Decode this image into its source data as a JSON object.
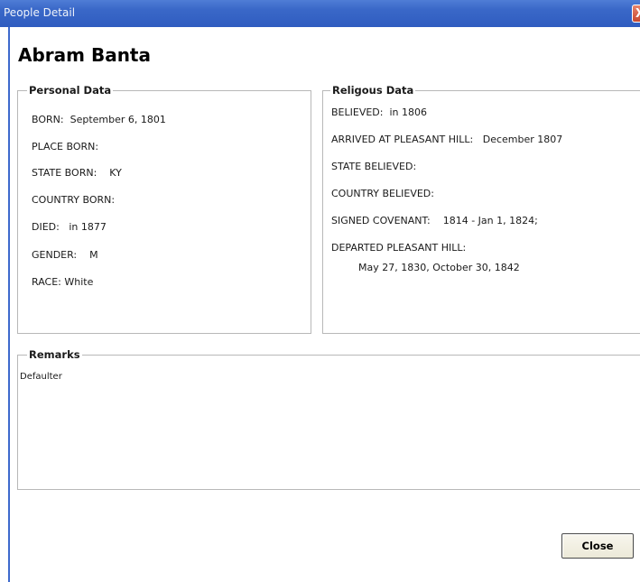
{
  "window": {
    "title": "People Detail",
    "close_glyph": "X"
  },
  "person": {
    "name": "Abram Banta"
  },
  "personal": {
    "legend": "Personal Data",
    "born": "BORN:  September 6, 1801",
    "place_born": "PLACE BORN:",
    "state_born": "STATE BORN:    KY",
    "country_born": "COUNTRY BORN:",
    "died": "DIED:   in 1877",
    "gender": "GENDER:    M",
    "race": "RACE: White"
  },
  "religious": {
    "legend": "Religous Data",
    "believed": "BELIEVED:  in 1806",
    "arrived": "ARRIVED AT PLEASANT HILL:   December 1807",
    "state_believed": "STATE BELIEVED:",
    "country_believed": "COUNTRY BELIEVED:",
    "signed_covenant": "SIGNED COVENANT:    1814 - Jan 1, 1824;",
    "departed_label": "DEPARTED PLEASANT HILL:",
    "departed_value": "May 27, 1830, October 30, 1842"
  },
  "remarks": {
    "legend": "Remarks",
    "text": "Defaulter"
  },
  "buttons": {
    "close_label": "Close"
  },
  "colors": {
    "titlebar": "#3a68c8",
    "close_x": "#d2573c",
    "group_border": "#b8b8b8",
    "button_face": "#ece9d8"
  },
  "icons": {
    "title_close": "close-icon"
  }
}
